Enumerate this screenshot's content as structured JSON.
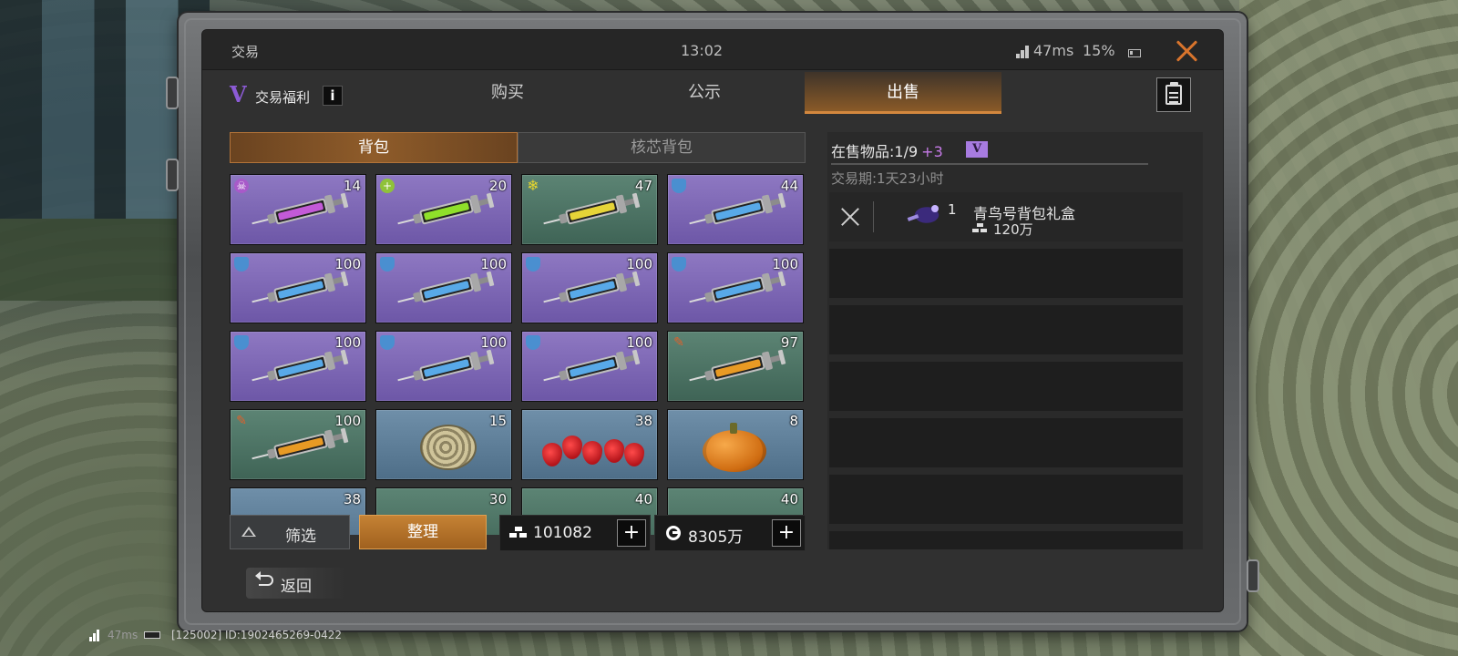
{
  "status_bar": {
    "title": "交易",
    "time": "13:02",
    "ping": "47ms",
    "battery": "15%"
  },
  "nav": {
    "vip_badge": "V",
    "vip_label": "交易福利",
    "info_icon": "i",
    "tabs": [
      {
        "label": "购买",
        "active": false
      },
      {
        "label": "公示",
        "active": false
      },
      {
        "label": "出售",
        "active": true
      }
    ]
  },
  "inventory": {
    "subtabs": [
      {
        "label": "背包",
        "active": true
      },
      {
        "label": "核芯背包",
        "active": false
      }
    ],
    "items": [
      {
        "kind": "syringe",
        "bg": "purple",
        "fluid": "#c35ad8",
        "badge": "poison",
        "count": "14"
      },
      {
        "kind": "syringe",
        "bg": "purple",
        "fluid": "#8fe02a",
        "badge": "heart",
        "count": "20"
      },
      {
        "kind": "syringe",
        "bg": "green",
        "fluid": "#e6d438",
        "badge": "cold",
        "count": "47"
      },
      {
        "kind": "syringe",
        "bg": "purple",
        "fluid": "#58a9e8",
        "badge": "shield",
        "count": "44"
      },
      {
        "kind": "syringe",
        "bg": "purple",
        "fluid": "#58a9e8",
        "badge": "shield",
        "count": "100"
      },
      {
        "kind": "syringe",
        "bg": "purple",
        "fluid": "#58a9e8",
        "badge": "shield",
        "count": "100"
      },
      {
        "kind": "syringe",
        "bg": "purple",
        "fluid": "#58a9e8",
        "badge": "shield",
        "count": "100"
      },
      {
        "kind": "syringe",
        "bg": "purple",
        "fluid": "#58a9e8",
        "badge": "shield",
        "count": "100"
      },
      {
        "kind": "syringe",
        "bg": "purple",
        "fluid": "#58a9e8",
        "badge": "shield",
        "count": "100"
      },
      {
        "kind": "syringe",
        "bg": "purple",
        "fluid": "#58a9e8",
        "badge": "shield",
        "count": "100"
      },
      {
        "kind": "syringe",
        "bg": "purple",
        "fluid": "#58a9e8",
        "badge": "shield",
        "count": "100"
      },
      {
        "kind": "syringe",
        "bg": "green",
        "fluid": "#e89a24",
        "badge": "fire",
        "count": "97"
      },
      {
        "kind": "syringe",
        "bg": "green",
        "fluid": "#e89a24",
        "badge": "fire",
        "count": "100"
      },
      {
        "kind": "ammonite",
        "bg": "blue",
        "badge": "",
        "count": "15"
      },
      {
        "kind": "strawberry",
        "bg": "blue",
        "badge": "",
        "count": "38"
      },
      {
        "kind": "pumpkin",
        "bg": "blue",
        "badge": "",
        "count": "8"
      },
      {
        "kind": "partial",
        "bg": "blue",
        "badge": "",
        "count": "38"
      },
      {
        "kind": "partial",
        "bg": "green",
        "badge": "",
        "count": "30"
      },
      {
        "kind": "partial",
        "bg": "green",
        "badge": "",
        "count": "40"
      },
      {
        "kind": "partial",
        "bg": "green",
        "badge": "",
        "count": "40"
      }
    ],
    "filter_label": "筛选",
    "sort_label": "整理",
    "gold_amount": "101082",
    "coin_amount": "8305万",
    "plus": "+",
    "back_label": "返回"
  },
  "sale": {
    "title_prefix": "在售物品:",
    "slots": "1/9",
    "bonus": "+3",
    "vip_chip": "V",
    "period": "交易期:1天23小时",
    "listings": [
      {
        "qty": "1",
        "name": "青鸟号背包礼盒",
        "price": "120万"
      }
    ],
    "empty_rows": 5
  },
  "hud": {
    "ping": "47ms",
    "id_text": "[125002] ID:1902465269-0422"
  },
  "icons": {
    "close": "close-icon",
    "clipboard": "clipboard-icon",
    "filter": "filter-triangle-icon",
    "gold": "gold-bars-icon",
    "coin": "coin-icon",
    "back": "back-arrow-icon"
  },
  "colors": {
    "accent_orange": "#d3873e",
    "purple_rarity": "#7d67b5",
    "green_rarity": "#4d7464",
    "blue_rarity": "#5d7d97",
    "vip_purple": "#a77be0"
  }
}
